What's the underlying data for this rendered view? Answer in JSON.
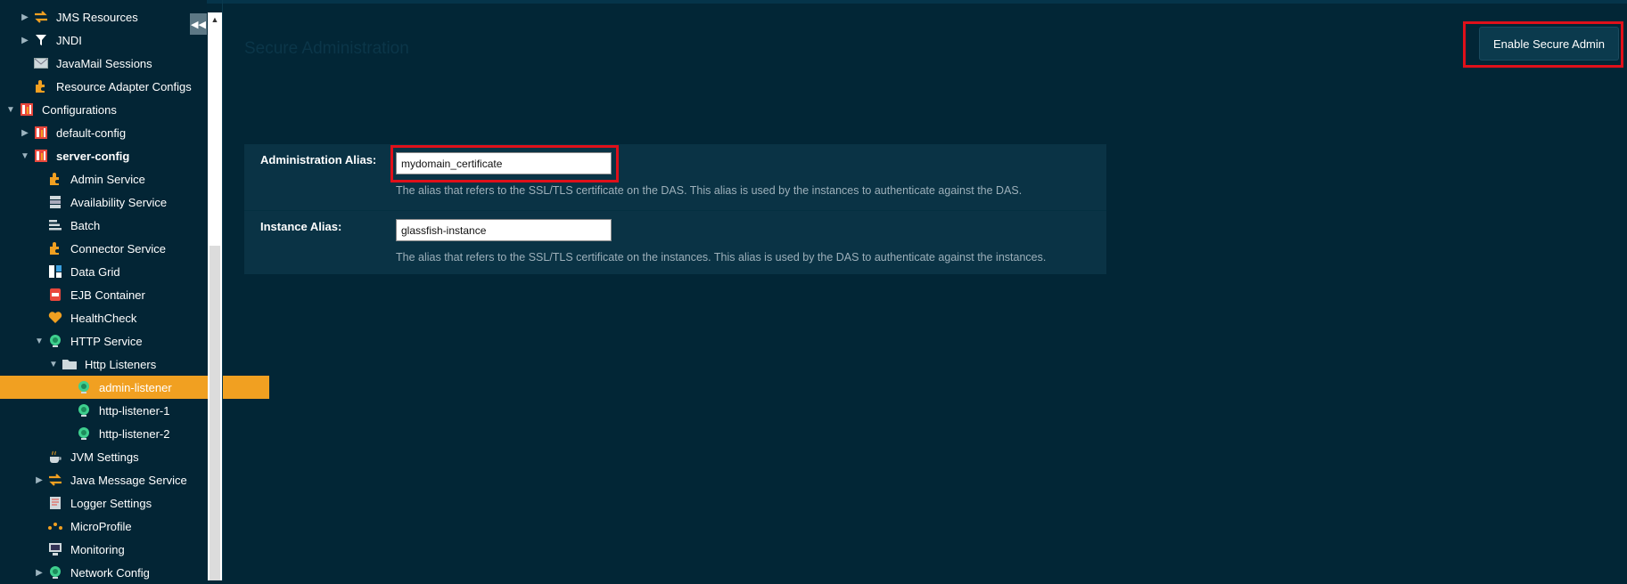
{
  "sidebar": {
    "collapse_icon": "double-chevron-left-icon",
    "items": [
      {
        "label": "JMS Resources",
        "arrow": "▶",
        "icon": "arrows-exchange-icon",
        "indent": 0,
        "bold": false,
        "selected": false
      },
      {
        "label": "JNDI",
        "arrow": "▶",
        "icon": "filter-icon",
        "indent": 0,
        "bold": false,
        "selected": false
      },
      {
        "label": "JavaMail Sessions",
        "arrow": "",
        "icon": "mail-icon",
        "indent": 0,
        "bold": false,
        "selected": false
      },
      {
        "label": "Resource Adapter Configs",
        "arrow": "",
        "icon": "puzzle-icon",
        "indent": 0,
        "bold": false,
        "selected": false
      },
      {
        "label": "Configurations",
        "arrow": "▼",
        "icon": "config-icon",
        "indent": -1,
        "bold": false,
        "selected": false
      },
      {
        "label": "default-config",
        "arrow": "▶",
        "icon": "config-icon",
        "indent": 0,
        "bold": false,
        "selected": false
      },
      {
        "label": "server-config",
        "arrow": "▼",
        "icon": "config-icon",
        "indent": 0,
        "bold": true,
        "selected": false
      },
      {
        "label": "Admin Service",
        "arrow": "",
        "icon": "puzzle-icon",
        "indent": 1,
        "bold": false,
        "selected": false
      },
      {
        "label": "Availability Service",
        "arrow": "",
        "icon": "server-icon",
        "indent": 1,
        "bold": false,
        "selected": false
      },
      {
        "label": "Batch",
        "arrow": "",
        "icon": "batch-icon",
        "indent": 1,
        "bold": false,
        "selected": false
      },
      {
        "label": "Connector Service",
        "arrow": "",
        "icon": "puzzle-icon",
        "indent": 1,
        "bold": false,
        "selected": false
      },
      {
        "label": "Data Grid",
        "arrow": "",
        "icon": "grid-icon",
        "indent": 1,
        "bold": false,
        "selected": false
      },
      {
        "label": "EJB Container",
        "arrow": "",
        "icon": "jar-icon",
        "indent": 1,
        "bold": false,
        "selected": false
      },
      {
        "label": "HealthCheck",
        "arrow": "",
        "icon": "heart-icon",
        "indent": 1,
        "bold": false,
        "selected": false
      },
      {
        "label": "HTTP Service",
        "arrow": "▼",
        "icon": "globe-icon",
        "indent": 1,
        "bold": false,
        "selected": false
      },
      {
        "label": "Http Listeners",
        "arrow": "▼",
        "icon": "folder-icon",
        "indent": 2,
        "bold": false,
        "selected": false
      },
      {
        "label": "admin-listener",
        "arrow": "",
        "icon": "globe-icon",
        "indent": 3,
        "bold": false,
        "selected": true
      },
      {
        "label": "http-listener-1",
        "arrow": "",
        "icon": "globe-icon",
        "indent": 3,
        "bold": false,
        "selected": false
      },
      {
        "label": "http-listener-2",
        "arrow": "",
        "icon": "globe-icon",
        "indent": 3,
        "bold": false,
        "selected": false
      },
      {
        "label": "JVM Settings",
        "arrow": "",
        "icon": "coffee-icon",
        "indent": 1,
        "bold": false,
        "selected": false
      },
      {
        "label": "Java Message Service",
        "arrow": "▶",
        "icon": "arrows-exchange-icon",
        "indent": 1,
        "bold": false,
        "selected": false
      },
      {
        "label": "Logger Settings",
        "arrow": "",
        "icon": "log-icon",
        "indent": 1,
        "bold": false,
        "selected": false
      },
      {
        "label": "MicroProfile",
        "arrow": "",
        "icon": "microprofile-icon",
        "indent": 1,
        "bold": false,
        "selected": false
      },
      {
        "label": "Monitoring",
        "arrow": "",
        "icon": "monitor-icon",
        "indent": 1,
        "bold": false,
        "selected": false
      },
      {
        "label": "Network Config",
        "arrow": "▶",
        "icon": "globe-icon",
        "indent": 1,
        "bold": false,
        "selected": false
      }
    ]
  },
  "main": {
    "title": "Secure Administration",
    "enable_button_label": "Enable Secure Admin",
    "form": {
      "admin_alias_label": "Administration Alias:",
      "admin_alias_value": "mydomain_certificate",
      "admin_alias_help": "The alias that refers to the SSL/TLS certificate on the DAS. This alias is used by the instances to authenticate against the DAS.",
      "instance_alias_label": "Instance Alias:",
      "instance_alias_value": "glassfish-instance",
      "instance_alias_help": "The alias that refers to the SSL/TLS certificate on the instances. This alias is used by the DAS to authenticate against the instances."
    }
  },
  "colors": {
    "background": "#022636",
    "selected_row": "#f1a021",
    "highlight_box": "#e0101a",
    "icon_orange": "#f1a021",
    "icon_green": "#3ecf8e"
  }
}
